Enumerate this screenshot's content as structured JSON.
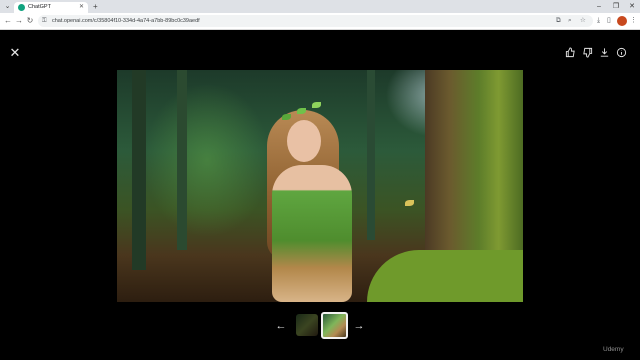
{
  "browser": {
    "tab_title": "ChatGPT",
    "new_tab_icon": "plus-icon",
    "url": "chat.openai.com/c/35804f10-334d-4a74-a7bb-89bc0c39aedf",
    "window_controls": [
      "minimize-icon",
      "restore-icon",
      "close-icon"
    ]
  },
  "viewer": {
    "actions": [
      "thumbs-up-icon",
      "thumbs-down-icon",
      "download-icon",
      "info-icon"
    ],
    "image_description": "",
    "thumbnail_count": 2,
    "selected_thumbnail": 2
  },
  "watermark": "Udemy",
  "colors": {
    "viewer_bg": "#000000",
    "tab_strip": "#dee1e6",
    "selected_thumb_border": "#f2f2f2"
  }
}
